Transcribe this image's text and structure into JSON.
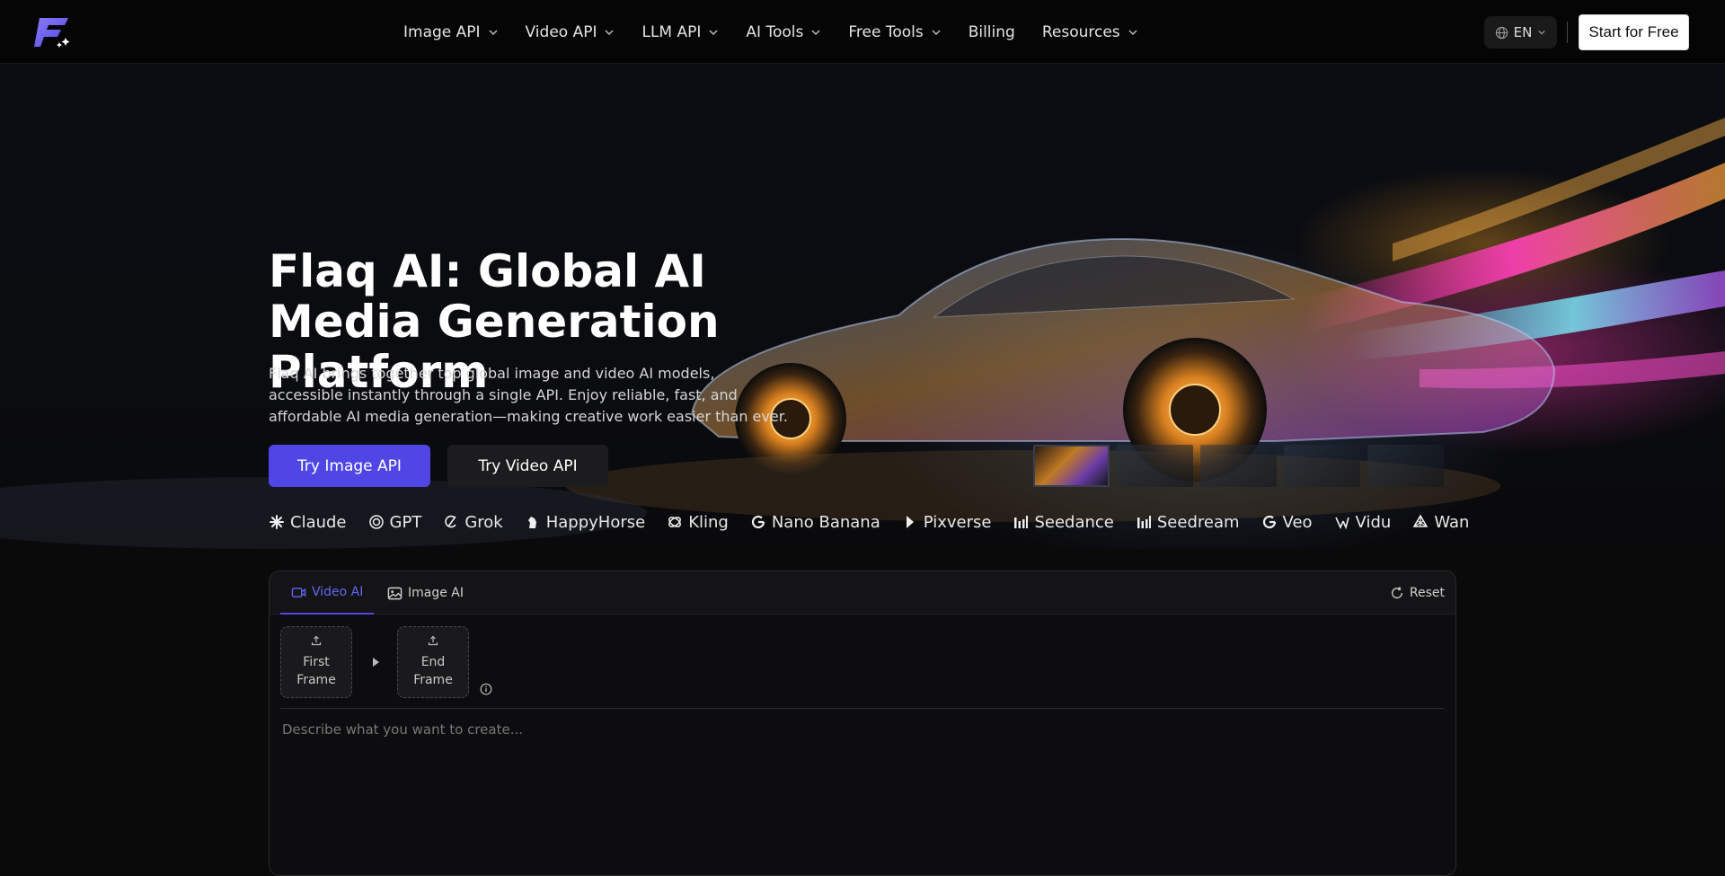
{
  "nav": {
    "items": [
      {
        "label": "Image API",
        "has_dropdown": true
      },
      {
        "label": "Video API",
        "has_dropdown": true
      },
      {
        "label": "LLM API",
        "has_dropdown": true
      },
      {
        "label": "AI Tools",
        "has_dropdown": true
      },
      {
        "label": "Free Tools",
        "has_dropdown": true
      },
      {
        "label": "Billing",
        "has_dropdown": false
      },
      {
        "label": "Resources",
        "has_dropdown": true
      }
    ],
    "language": "EN",
    "cta": "Start for Free"
  },
  "hero": {
    "title": "Flaq AI: Global AI Media Generation Platform",
    "description": "Flaq AI brings together top global image and video AI models, accessible instantly through a single API. Enjoy reliable, fast, and affordable AI media generation—making creative work easier than ever.",
    "primary_button": "Try Image API",
    "secondary_button": "Try Video API",
    "models": [
      {
        "name": "Claude",
        "icon": "claude-icon"
      },
      {
        "name": "GPT",
        "icon": "openai-icon"
      },
      {
        "name": "Grok",
        "icon": "grok-icon"
      },
      {
        "name": "HappyHorse",
        "icon": "horse-icon"
      },
      {
        "name": "Kling",
        "icon": "kling-icon"
      },
      {
        "name": "Nano Banana",
        "icon": "google-icon"
      },
      {
        "name": "Pixverse",
        "icon": "pixverse-icon"
      },
      {
        "name": "Seedance",
        "icon": "bars-icon"
      },
      {
        "name": "Seedream",
        "icon": "bars-icon"
      },
      {
        "name": "Veo",
        "icon": "google-icon"
      },
      {
        "name": "Vidu",
        "icon": "vidu-icon"
      },
      {
        "name": "Wan",
        "icon": "wan-icon"
      }
    ]
  },
  "creator": {
    "tabs": [
      {
        "label": "Video AI",
        "active": true,
        "icon": "video-icon"
      },
      {
        "label": "Image AI",
        "active": false,
        "icon": "image-icon"
      }
    ],
    "reset_label": "Reset",
    "first_frame_label": "First Frame",
    "end_frame_label": "End Frame",
    "prompt_placeholder": "Describe what you want to create..."
  },
  "colors": {
    "accent": "#4f46e5",
    "background": "#0a0a0a"
  }
}
